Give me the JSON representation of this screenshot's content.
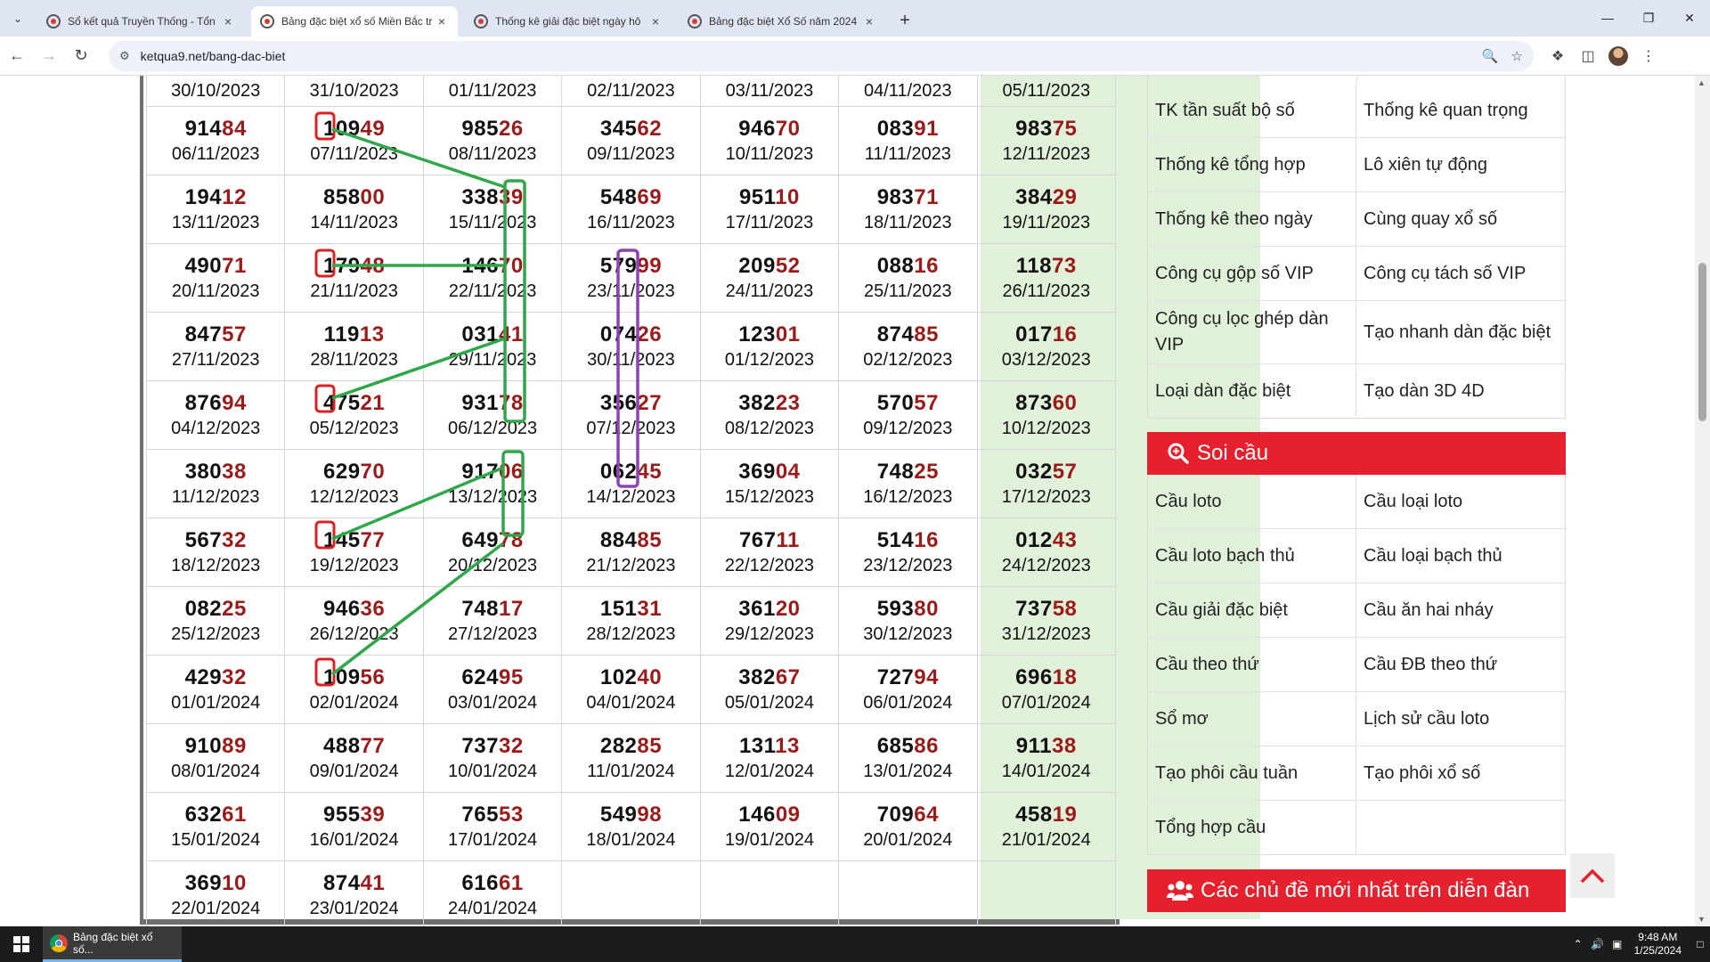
{
  "browser": {
    "tabs": [
      {
        "title": "Sổ kết quả Truyền Thống - Tổn",
        "active": false
      },
      {
        "title": "Bảng đặc biệt xổ số Miền Bắc tr",
        "active": true
      },
      {
        "title": "Thống kê giải đặc biệt ngày hô",
        "active": false
      },
      {
        "title": "Bảng đặc biệt Xổ Số năm 2024",
        "active": false
      }
    ],
    "url": "ketqua9.net/bang-dac-biet"
  },
  "results": {
    "header_dates": [
      "30/10/2023",
      "31/10/2023",
      "01/11/2023",
      "02/11/2023",
      "03/11/2023",
      "04/11/2023",
      "05/11/2023"
    ],
    "rows": [
      [
        {
          "h": "914",
          "t": "84",
          "d": "06/11/2023"
        },
        {
          "h": "109",
          "t": "49",
          "d": "07/11/2023"
        },
        {
          "h": "985",
          "t": "26",
          "d": "08/11/2023"
        },
        {
          "h": "345",
          "t": "62",
          "d": "09/11/2023"
        },
        {
          "h": "946",
          "t": "70",
          "d": "10/11/2023"
        },
        {
          "h": "083",
          "t": "91",
          "d": "11/11/2023"
        },
        {
          "h": "983",
          "t": "75",
          "d": "12/11/2023"
        }
      ],
      [
        {
          "h": "194",
          "t": "12",
          "d": "13/11/2023"
        },
        {
          "h": "858",
          "t": "00",
          "d": "14/11/2023"
        },
        {
          "h": "338",
          "t": "39",
          "d": "15/11/2023"
        },
        {
          "h": "548",
          "t": "69",
          "d": "16/11/2023"
        },
        {
          "h": "951",
          "t": "10",
          "d": "17/11/2023"
        },
        {
          "h": "983",
          "t": "71",
          "d": "18/11/2023"
        },
        {
          "h": "384",
          "t": "29",
          "d": "19/11/2023"
        }
      ],
      [
        {
          "h": "490",
          "t": "71",
          "d": "20/11/2023"
        },
        {
          "h": "179",
          "t": "48",
          "d": "21/11/2023"
        },
        {
          "h": "146",
          "t": "70",
          "d": "22/11/2023"
        },
        {
          "h": "579",
          "t": "99",
          "d": "23/11/2023"
        },
        {
          "h": "209",
          "t": "52",
          "d": "24/11/2023"
        },
        {
          "h": "088",
          "t": "16",
          "d": "25/11/2023"
        },
        {
          "h": "118",
          "t": "73",
          "d": "26/11/2023"
        }
      ],
      [
        {
          "h": "847",
          "t": "57",
          "d": "27/11/2023"
        },
        {
          "h": "119",
          "t": "13",
          "d": "28/11/2023"
        },
        {
          "h": "031",
          "t": "41",
          "d": "29/11/2023"
        },
        {
          "h": "074",
          "t": "26",
          "d": "30/11/2023"
        },
        {
          "h": "123",
          "t": "01",
          "d": "01/12/2023"
        },
        {
          "h": "874",
          "t": "85",
          "d": "02/12/2023"
        },
        {
          "h": "017",
          "t": "16",
          "d": "03/12/2023"
        }
      ],
      [
        {
          "h": "876",
          "t": "94",
          "d": "04/12/2023"
        },
        {
          "h": "475",
          "t": "21",
          "d": "05/12/2023"
        },
        {
          "h": "931",
          "t": "78",
          "d": "06/12/2023"
        },
        {
          "h": "356",
          "t": "27",
          "d": "07/12/2023"
        },
        {
          "h": "382",
          "t": "23",
          "d": "08/12/2023"
        },
        {
          "h": "570",
          "t": "57",
          "d": "09/12/2023"
        },
        {
          "h": "873",
          "t": "60",
          "d": "10/12/2023"
        }
      ],
      [
        {
          "h": "380",
          "t": "38",
          "d": "11/12/2023"
        },
        {
          "h": "629",
          "t": "70",
          "d": "12/12/2023"
        },
        {
          "h": "917",
          "t": "06",
          "d": "13/12/2023"
        },
        {
          "h": "062",
          "t": "45",
          "d": "14/12/2023"
        },
        {
          "h": "369",
          "t": "04",
          "d": "15/12/2023"
        },
        {
          "h": "748",
          "t": "25",
          "d": "16/12/2023"
        },
        {
          "h": "032",
          "t": "57",
          "d": "17/12/2023"
        }
      ],
      [
        {
          "h": "567",
          "t": "32",
          "d": "18/12/2023"
        },
        {
          "h": "145",
          "t": "77",
          "d": "19/12/2023"
        },
        {
          "h": "649",
          "t": "78",
          "d": "20/12/2023"
        },
        {
          "h": "884",
          "t": "85",
          "d": "21/12/2023"
        },
        {
          "h": "767",
          "t": "11",
          "d": "22/12/2023"
        },
        {
          "h": "514",
          "t": "16",
          "d": "23/12/2023"
        },
        {
          "h": "012",
          "t": "43",
          "d": "24/12/2023"
        }
      ],
      [
        {
          "h": "082",
          "t": "25",
          "d": "25/12/2023"
        },
        {
          "h": "946",
          "t": "36",
          "d": "26/12/2023"
        },
        {
          "h": "748",
          "t": "17",
          "d": "27/12/2023"
        },
        {
          "h": "151",
          "t": "31",
          "d": "28/12/2023"
        },
        {
          "h": "361",
          "t": "20",
          "d": "29/12/2023"
        },
        {
          "h": "593",
          "t": "80",
          "d": "30/12/2023"
        },
        {
          "h": "737",
          "t": "58",
          "d": "31/12/2023"
        }
      ],
      [
        {
          "h": "429",
          "t": "32",
          "d": "01/01/2024"
        },
        {
          "h": "109",
          "t": "56",
          "d": "02/01/2024"
        },
        {
          "h": "624",
          "t": "95",
          "d": "03/01/2024"
        },
        {
          "h": "102",
          "t": "40",
          "d": "04/01/2024"
        },
        {
          "h": "382",
          "t": "67",
          "d": "05/01/2024"
        },
        {
          "h": "727",
          "t": "94",
          "d": "06/01/2024"
        },
        {
          "h": "696",
          "t": "18",
          "d": "07/01/2024"
        }
      ],
      [
        {
          "h": "910",
          "t": "89",
          "d": "08/01/2024"
        },
        {
          "h": "488",
          "t": "77",
          "d": "09/01/2024"
        },
        {
          "h": "737",
          "t": "32",
          "d": "10/01/2024"
        },
        {
          "h": "282",
          "t": "85",
          "d": "11/01/2024"
        },
        {
          "h": "131",
          "t": "13",
          "d": "12/01/2024"
        },
        {
          "h": "685",
          "t": "86",
          "d": "13/01/2024"
        },
        {
          "h": "911",
          "t": "38",
          "d": "14/01/2024"
        }
      ],
      [
        {
          "h": "632",
          "t": "61",
          "d": "15/01/2024"
        },
        {
          "h": "955",
          "t": "39",
          "d": "16/01/2024"
        },
        {
          "h": "765",
          "t": "53",
          "d": "17/01/2024"
        },
        {
          "h": "549",
          "t": "98",
          "d": "18/01/2024"
        },
        {
          "h": "146",
          "t": "09",
          "d": "19/01/2024"
        },
        {
          "h": "709",
          "t": "64",
          "d": "20/01/2024"
        },
        {
          "h": "458",
          "t": "19",
          "d": "21/01/2024"
        }
      ],
      [
        {
          "h": "369",
          "t": "10",
          "d": "22/01/2024"
        },
        {
          "h": "874",
          "t": "41",
          "d": "23/01/2024"
        },
        {
          "h": "616",
          "t": "61",
          "d": "24/01/2024"
        },
        null,
        null,
        null,
        null
      ]
    ]
  },
  "sidebar": {
    "links": [
      [
        "TK tần suất bộ số",
        "Thống kê quan trọng"
      ],
      [
        "Thống kê tổng hợp",
        "Lô xiên tự động"
      ],
      [
        "Thống kê theo ngày",
        "Cùng quay xổ số"
      ],
      [
        "Công cụ gộp số VIP",
        "Công cụ tách số VIP"
      ],
      [
        "Công cụ lọc ghép dàn VIP",
        "Tạo nhanh dàn đặc biệt"
      ],
      [
        "Loại dàn đặc biệt",
        "Tạo dàn 3D 4D"
      ]
    ],
    "soi_cau": {
      "title": "Soi cầu",
      "links": [
        [
          "Cầu loto",
          "Cầu loại loto"
        ],
        [
          "Cầu loto bạch thủ",
          "Cầu loại bạch thủ"
        ],
        [
          "Cầu giải đặc biệt",
          "Cầu ăn hai nháy"
        ],
        [
          "Cầu theo thứ",
          "Cầu ĐB theo thứ"
        ],
        [
          "Sổ mơ",
          "Lịch sử cầu loto"
        ],
        [
          "Tạo phôi cầu tuần",
          "Tạo phôi xổ số"
        ],
        [
          "Tổng hợp cầu",
          ""
        ]
      ]
    },
    "forum": {
      "title": "Các chủ đề mới nhất trên diễn đàn"
    }
  },
  "taskbar": {
    "app_label": "Bảng đặc biệt xổ số...",
    "time": "9:48 AM",
    "date": "1/25/2024"
  },
  "colors": {
    "accent_red": "#e6202c",
    "tail_red": "#9b1b1b",
    "weekend_green": "#e1f1d9",
    "mark_green": "#2ea84a",
    "mark_purple": "#8e44ad",
    "box_red": "#e02020"
  }
}
